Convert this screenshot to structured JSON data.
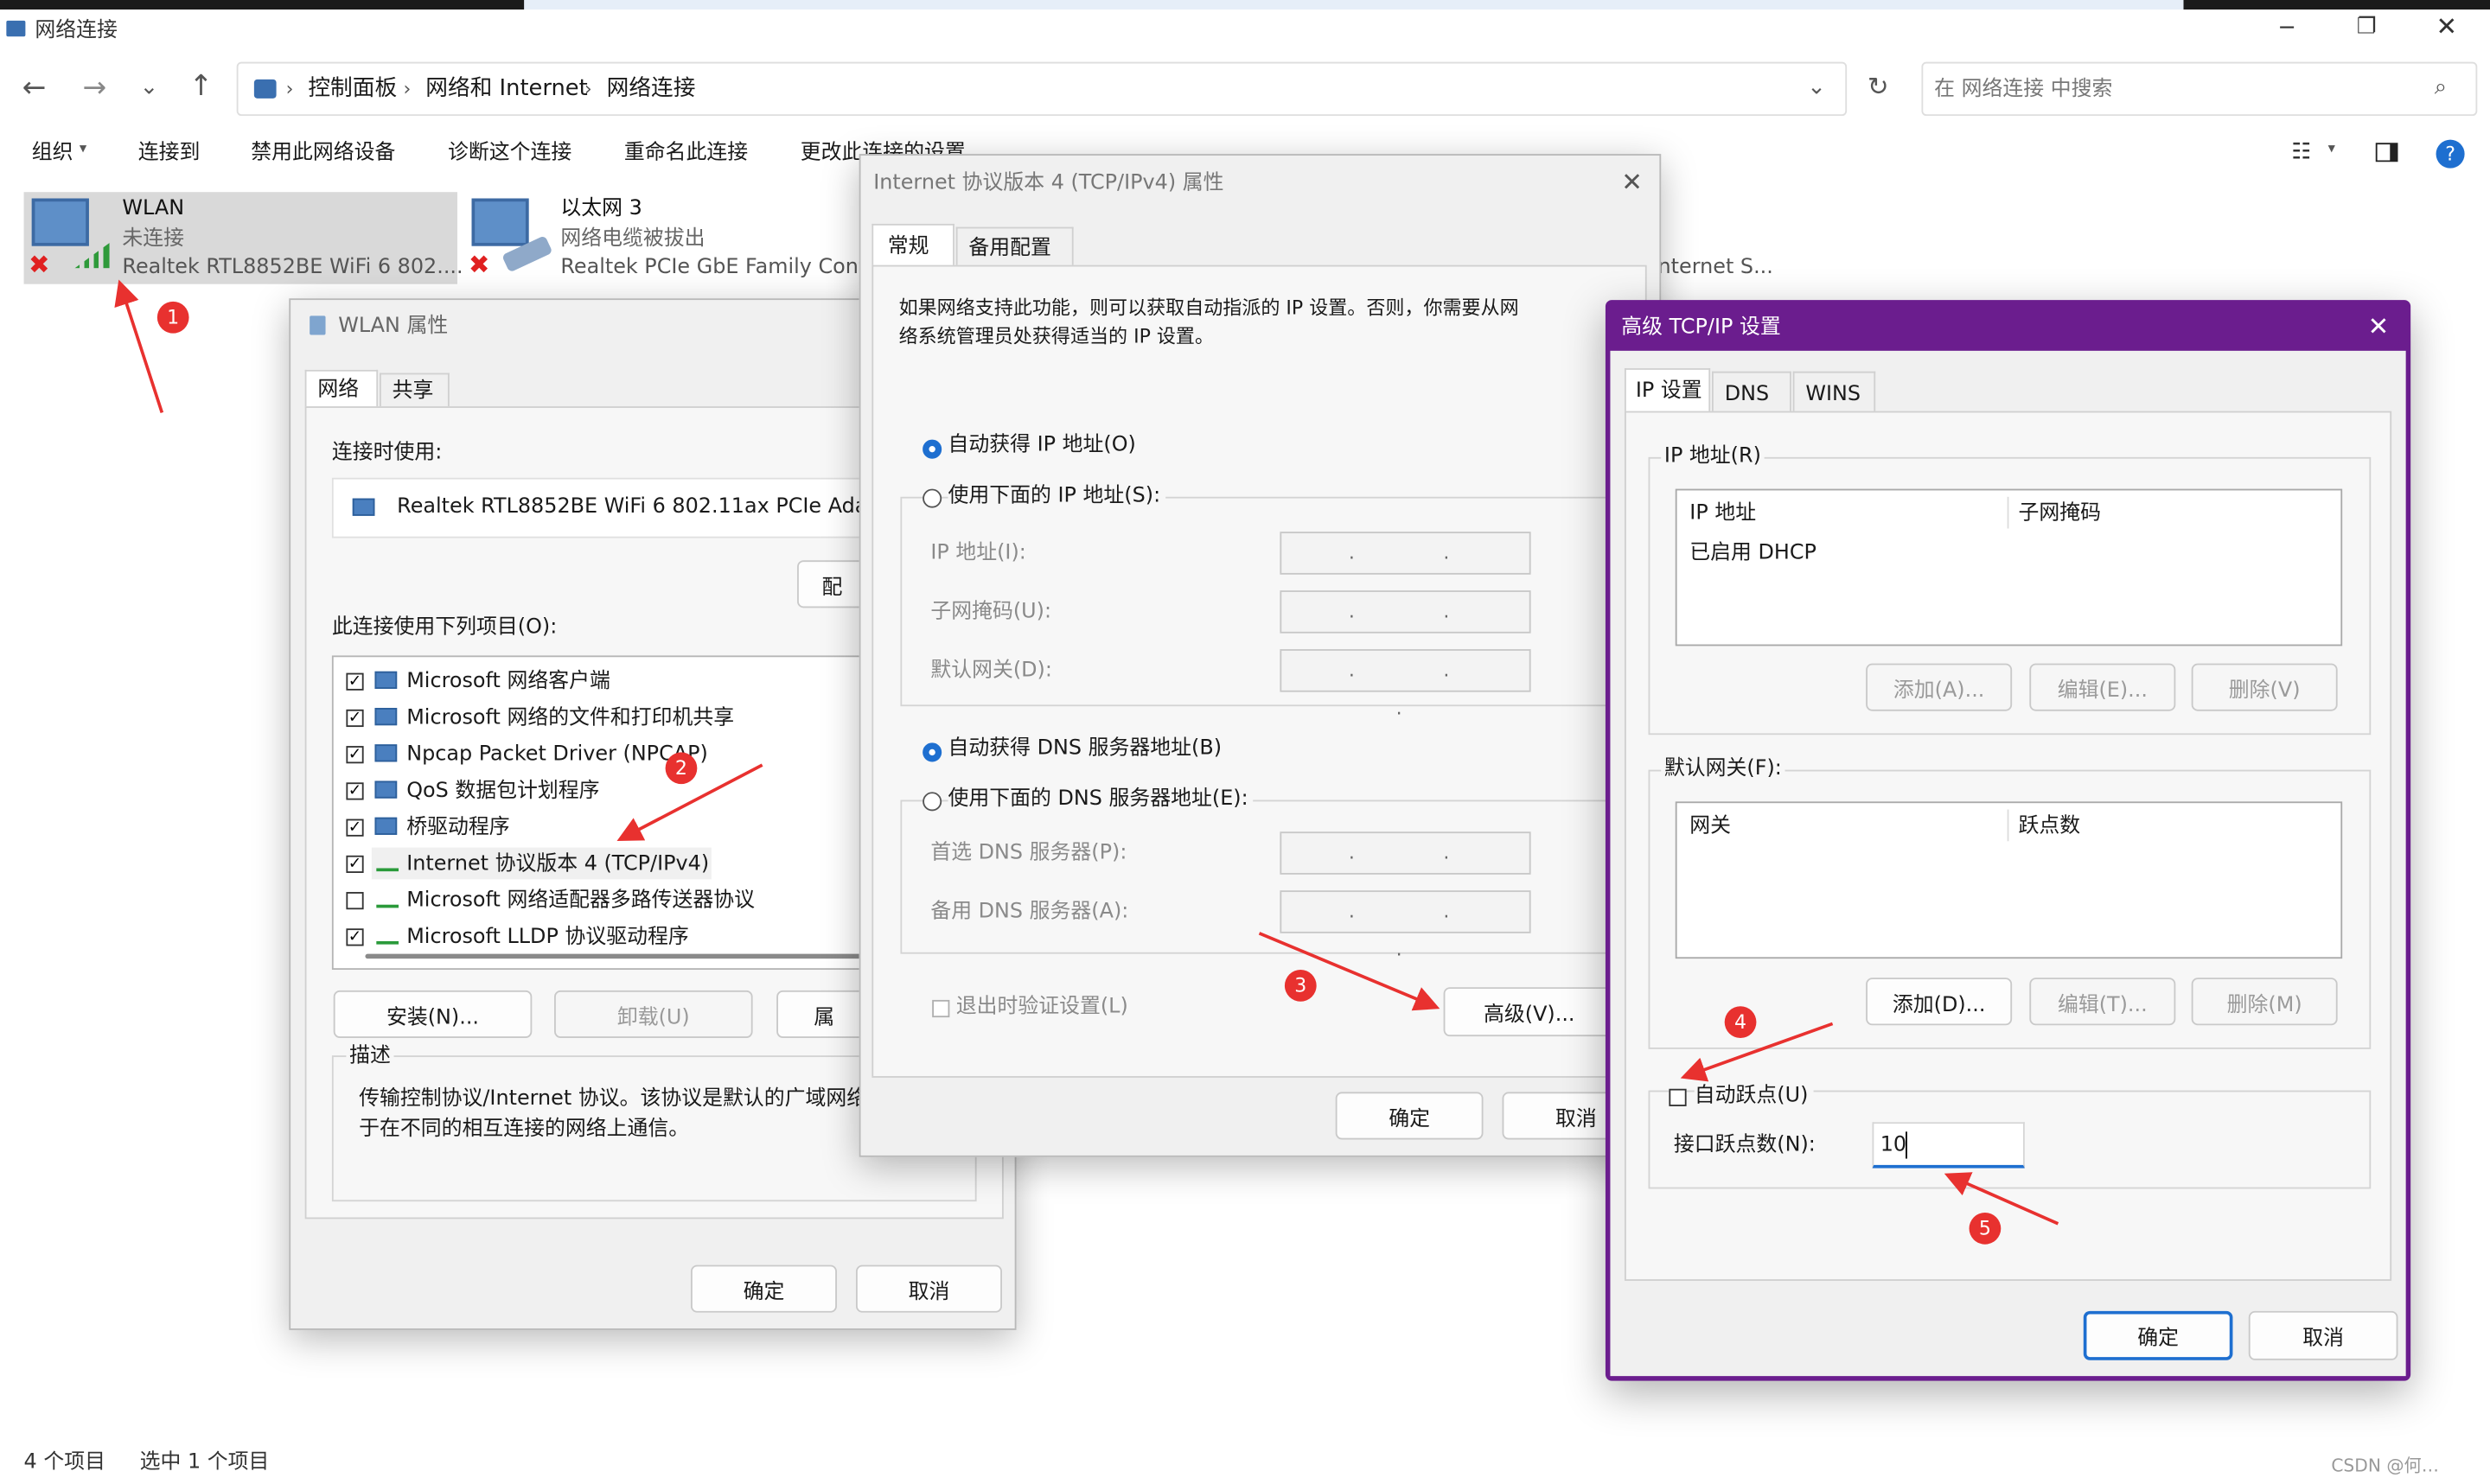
{
  "window": {
    "title": "网络连接"
  },
  "nav": {
    "breadcrumb": [
      "控制面板",
      "网络和 Internet",
      "网络连接"
    ],
    "search_placeholder": "在 网络连接 中搜索"
  },
  "toolbar": {
    "items": [
      "组织",
      "连接到",
      "禁用此网络设备",
      "诊断这个连接",
      "重命名此连接",
      "更改此连接的设置"
    ]
  },
  "connections": [
    {
      "name": "WLAN",
      "status": "未连接",
      "device": "Realtek RTL8852BE WiFi 6 802...."
    },
    {
      "name": "以太网 3",
      "status": "网络电缆被拔出",
      "device": "Realtek PCIe GbE Family Contr..."
    },
    {
      "partial": "nternet S..."
    }
  ],
  "status_bar": {
    "count": "4 个项目",
    "selected": "选中 1 个项目",
    "watermark": "CSDN @何…"
  },
  "wlan_dialog": {
    "title": "WLAN 属性",
    "tabs": [
      "网络",
      "共享"
    ],
    "connect_using_label": "连接时使用:",
    "adapter": "Realtek RTL8852BE WiFi 6 802.11ax PCIe Adap",
    "configure_btn": "配",
    "items_label": "此连接使用下列项目(O):",
    "items": [
      {
        "label": "Microsoft 网络客户端",
        "checked": true
      },
      {
        "label": "Microsoft 网络的文件和打印机共享",
        "checked": true
      },
      {
        "label": "Npcap Packet Driver (NPCAP)",
        "checked": true
      },
      {
        "label": "QoS 数据包计划程序",
        "checked": true
      },
      {
        "label": "桥驱动程序",
        "checked": true
      },
      {
        "label": "Internet 协议版本 4 (TCP/IPv4)",
        "checked": true
      },
      {
        "label": "Microsoft 网络适配器多路传送器协议",
        "checked": false
      },
      {
        "label": "Microsoft LLDP 协议驱动程序",
        "checked": true
      }
    ],
    "install_btn": "安装(N)...",
    "uninstall_btn": "卸载(U)",
    "properties_btn": "属",
    "desc_title": "描述",
    "desc_line1": "传输控制协议/Internet 协议。该协议是默认的广域网络",
    "desc_line2": "于在不同的相互连接的网络上通信。",
    "ok": "确定",
    "cancel": "取消"
  },
  "ipv4_dialog": {
    "title": "Internet 协议版本 4 (TCP/IPv4) 属性",
    "tabs": [
      "常规",
      "备用配置"
    ],
    "intro_line1": "如果网络支持此功能，则可以获取自动指派的 IP 设置。否则，你需要从网",
    "intro_line2": "络系统管理员处获得适当的 IP 设置。",
    "auto_ip": "自动获得 IP 地址(O)",
    "manual_ip": "使用下面的 IP 地址(S):",
    "ip_label": "IP 地址(I):",
    "mask_label": "子网掩码(U):",
    "gateway_label": "默认网关(D):",
    "auto_dns": "自动获得 DNS 服务器地址(B)",
    "manual_dns": "使用下面的 DNS 服务器地址(E):",
    "dns1_label": "首选 DNS 服务器(P):",
    "dns2_label": "备用 DNS 服务器(A):",
    "field_dots": ". . .",
    "validate_label": "退出时验证设置(L)",
    "advanced_btn": "高级(V)...",
    "ok": "确定",
    "cancel": "取消"
  },
  "adv_dialog": {
    "title": "高级 TCP/IP 设置",
    "tabs": [
      "IP 设置",
      "DNS",
      "WINS"
    ],
    "ip_group": "IP 地址(R)",
    "ip_col1": "IP 地址",
    "ip_col2": "子网掩码",
    "ip_row": "已启用 DHCP",
    "add_btn_ip": "添加(A)...",
    "edit_btn_ip": "编辑(E)...",
    "del_btn_ip": "删除(V)",
    "gw_group": "默认网关(F):",
    "gw_col1": "网关",
    "gw_col2": "跃点数",
    "add_btn_gw": "添加(D)...",
    "edit_btn_gw": "编辑(T)...",
    "del_btn_gw": "删除(M)",
    "auto_metric": "自动跃点(U)",
    "metric_label": "接口跃点数(N):",
    "metric_value": "10",
    "ok": "确定",
    "cancel": "取消"
  },
  "markers": [
    "1",
    "2",
    "3",
    "4",
    "5"
  ],
  "colors": {
    "accent": "#1e6fd0",
    "adv_frame": "#6b1d8e",
    "marker": "#e8312f"
  }
}
